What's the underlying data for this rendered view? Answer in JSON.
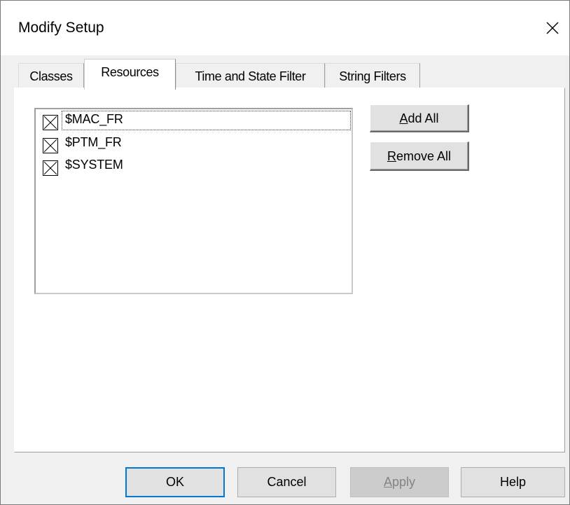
{
  "window": {
    "title": "Modify Setup",
    "close_icon": "close-icon"
  },
  "tabs": [
    {
      "label": "Classes",
      "active": false
    },
    {
      "label": "Resources",
      "active": true
    },
    {
      "label": "Time and State Filter",
      "active": false
    },
    {
      "label": "String Filters",
      "active": false
    }
  ],
  "resources_list": {
    "items": [
      {
        "label": "$MAC_FR",
        "checked": true,
        "focused": true
      },
      {
        "label": "$PTM_FR",
        "checked": true,
        "focused": false
      },
      {
        "label": "$SYSTEM",
        "checked": true,
        "focused": false
      }
    ]
  },
  "side_buttons": {
    "add_all": {
      "mnemonic": "A",
      "rest": "dd All"
    },
    "remove_all": {
      "mnemonic": "R",
      "rest": "emove All"
    }
  },
  "dialog_buttons": {
    "ok": "OK",
    "cancel": "Cancel",
    "apply": {
      "mnemonic": "A",
      "rest": "pply",
      "enabled": false
    },
    "help": "Help"
  },
  "colors": {
    "default_button_border": "#0078d7",
    "dialog_background": "#f0f0f0",
    "panel_background": "#ffffff"
  }
}
